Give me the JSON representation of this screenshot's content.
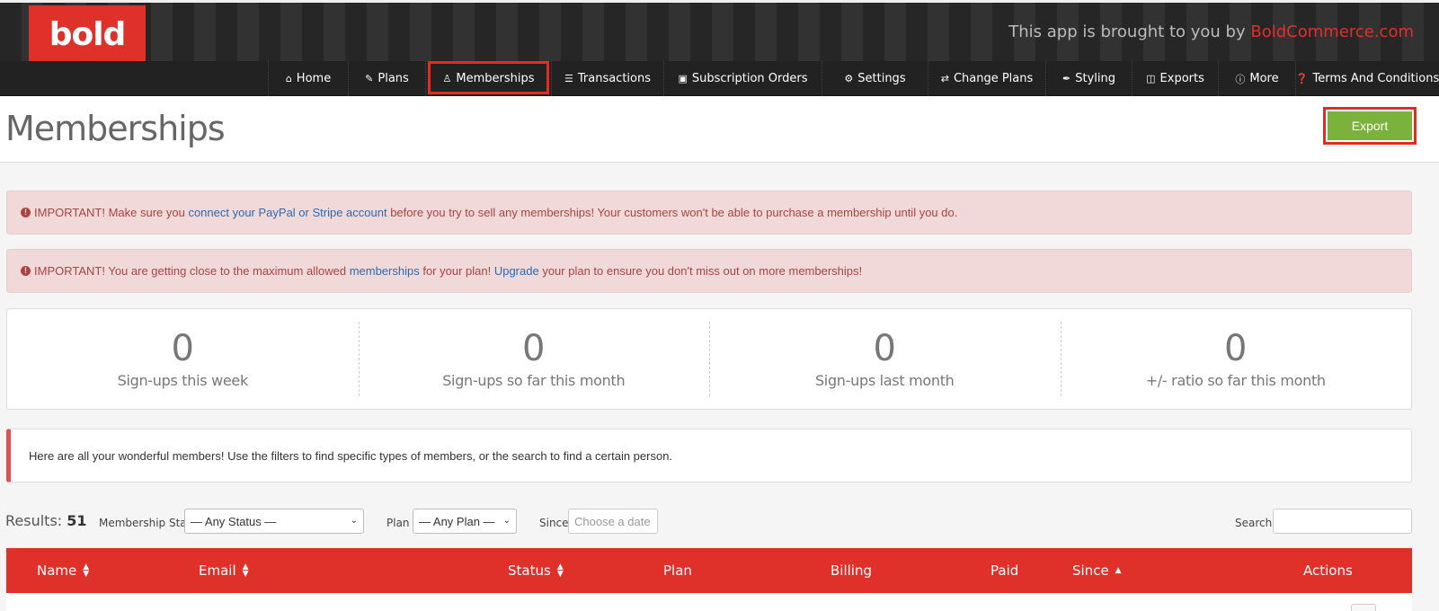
{
  "header": {
    "logo_text": "bold",
    "brought_prefix": "This app is brought to you by",
    "brought_link": "BoldCommerce.com"
  },
  "nav": {
    "items": [
      {
        "label": "Home",
        "icon": "home-icon"
      },
      {
        "label": "Plans",
        "icon": "edit-icon"
      },
      {
        "label": "Memberships",
        "icon": "users-icon"
      },
      {
        "label": "Transactions",
        "icon": "list-icon"
      },
      {
        "label": "Subscription Orders",
        "icon": "cart-icon"
      },
      {
        "label": "Settings",
        "icon": "gears-icon"
      },
      {
        "label": "Change Plans",
        "icon": "exchange-icon"
      },
      {
        "label": "Styling",
        "icon": "brush-icon"
      },
      {
        "label": "Exports",
        "icon": "file-icon"
      },
      {
        "label": "More",
        "icon": "info-icon"
      },
      {
        "label": "Terms And Conditions",
        "icon": "question-icon"
      }
    ],
    "active": "Memberships"
  },
  "page": {
    "title": "Memberships",
    "export_label": "Export"
  },
  "alerts": {
    "paypal": {
      "prefix": "IMPORTANT! Make sure you ",
      "link": "connect your PayPal or Stripe account",
      "suffix": " before you try to sell any memberships! Your customers won't be able to purchase a membership until you do."
    },
    "limit": {
      "prefix": "IMPORTANT! You are getting close to the maximum allowed ",
      "link1": "memberships",
      "middle": " for your plan! ",
      "link2": "Upgrade",
      "suffix": " your plan to ensure you don't miss out on more memberships!"
    }
  },
  "stats": [
    {
      "value": "0",
      "label": "Sign-ups this week"
    },
    {
      "value": "0",
      "label": "Sign-ups so far this month"
    },
    {
      "value": "0",
      "label": "Sign-ups last month"
    },
    {
      "value": "0",
      "label": "+/- ratio so far this month"
    }
  ],
  "info_text": "Here are all your wonderful members! Use the filters to find specific types of members, or the search to find a certain person.",
  "filters": {
    "results_label": "Results:",
    "results_count": "51",
    "status_label": "Membership Status",
    "status_value": "— Any Status —",
    "plan_label": "Plan",
    "plan_value": "— Any Plan —",
    "since_label": "Since",
    "since_placeholder": "Choose a date",
    "search_label": "Search:"
  },
  "table": {
    "columns": [
      "Name",
      "Email",
      "Status",
      "Plan",
      "Billing",
      "Paid",
      "Since",
      "Actions"
    ]
  },
  "colors": {
    "brand_red": "#e0302a",
    "export_green": "#7ab23c",
    "alert_bg": "#f2d9d9",
    "alert_text": "#a94442"
  }
}
